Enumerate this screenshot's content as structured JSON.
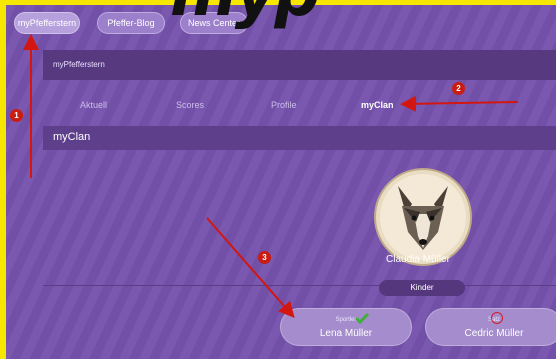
{
  "overlay_title": "myp",
  "topnav": {
    "items": [
      {
        "label": "myPfefferstern"
      },
      {
        "label": "Pfeffer-Blog"
      },
      {
        "label": "News Center"
      }
    ]
  },
  "panel": {
    "title": "myPfefferstern"
  },
  "tabs": [
    {
      "label": "Aktuell"
    },
    {
      "label": "Scores"
    },
    {
      "label": "Profile"
    },
    {
      "label": "myClan"
    }
  ],
  "section": {
    "title": "myClan"
  },
  "profile": {
    "name": "Claudia Müller",
    "badge": "Kinder",
    "avatar_icon": "wolf-icon"
  },
  "members": [
    {
      "role": "Sportler",
      "name": "Lena Müller",
      "status_icon": "checkmark-icon",
      "status_color": "#3fae3a"
    },
    {
      "role": "Satz",
      "name": "Cedric Müller",
      "status_icon": "alert-icon",
      "status_color": "#d11f1f"
    }
  ],
  "annotations": [
    {
      "label": "1"
    },
    {
      "label": "2"
    },
    {
      "label": "3"
    }
  ],
  "colors": {
    "background": "#f6e600",
    "app_purple": "#7a58b0",
    "arrow_red": "#d3160f"
  }
}
